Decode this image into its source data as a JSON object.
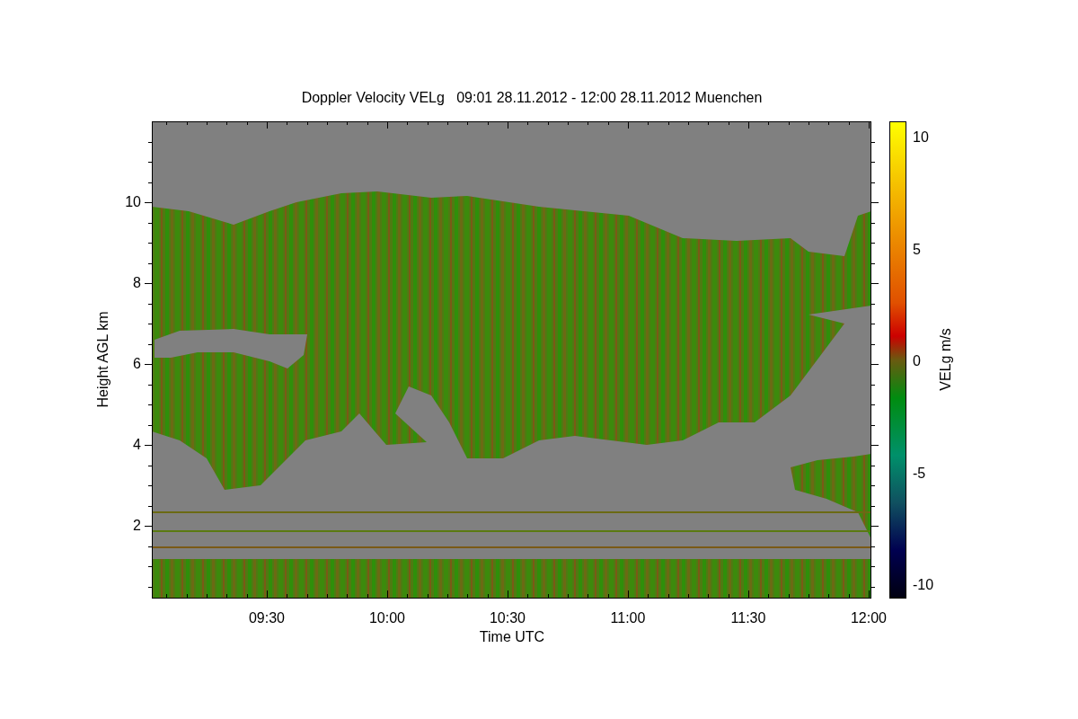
{
  "title": "Doppler Velocity VELg   09:01 28.11.2012 - 12:00 28.11.2012 Muenchen",
  "xlabel": "Time UTC",
  "ylabel": "Height AGL km",
  "xticks": [
    "09:30",
    "10:00",
    "10:30",
    "11:00",
    "11:30",
    "12:00"
  ],
  "yticks": [
    "10",
    "8",
    "6",
    "4",
    "2"
  ],
  "colorbar": {
    "label": "VELg m/s",
    "ticks": [
      "10",
      "5",
      "0",
      "-5",
      "-10"
    ]
  }
}
